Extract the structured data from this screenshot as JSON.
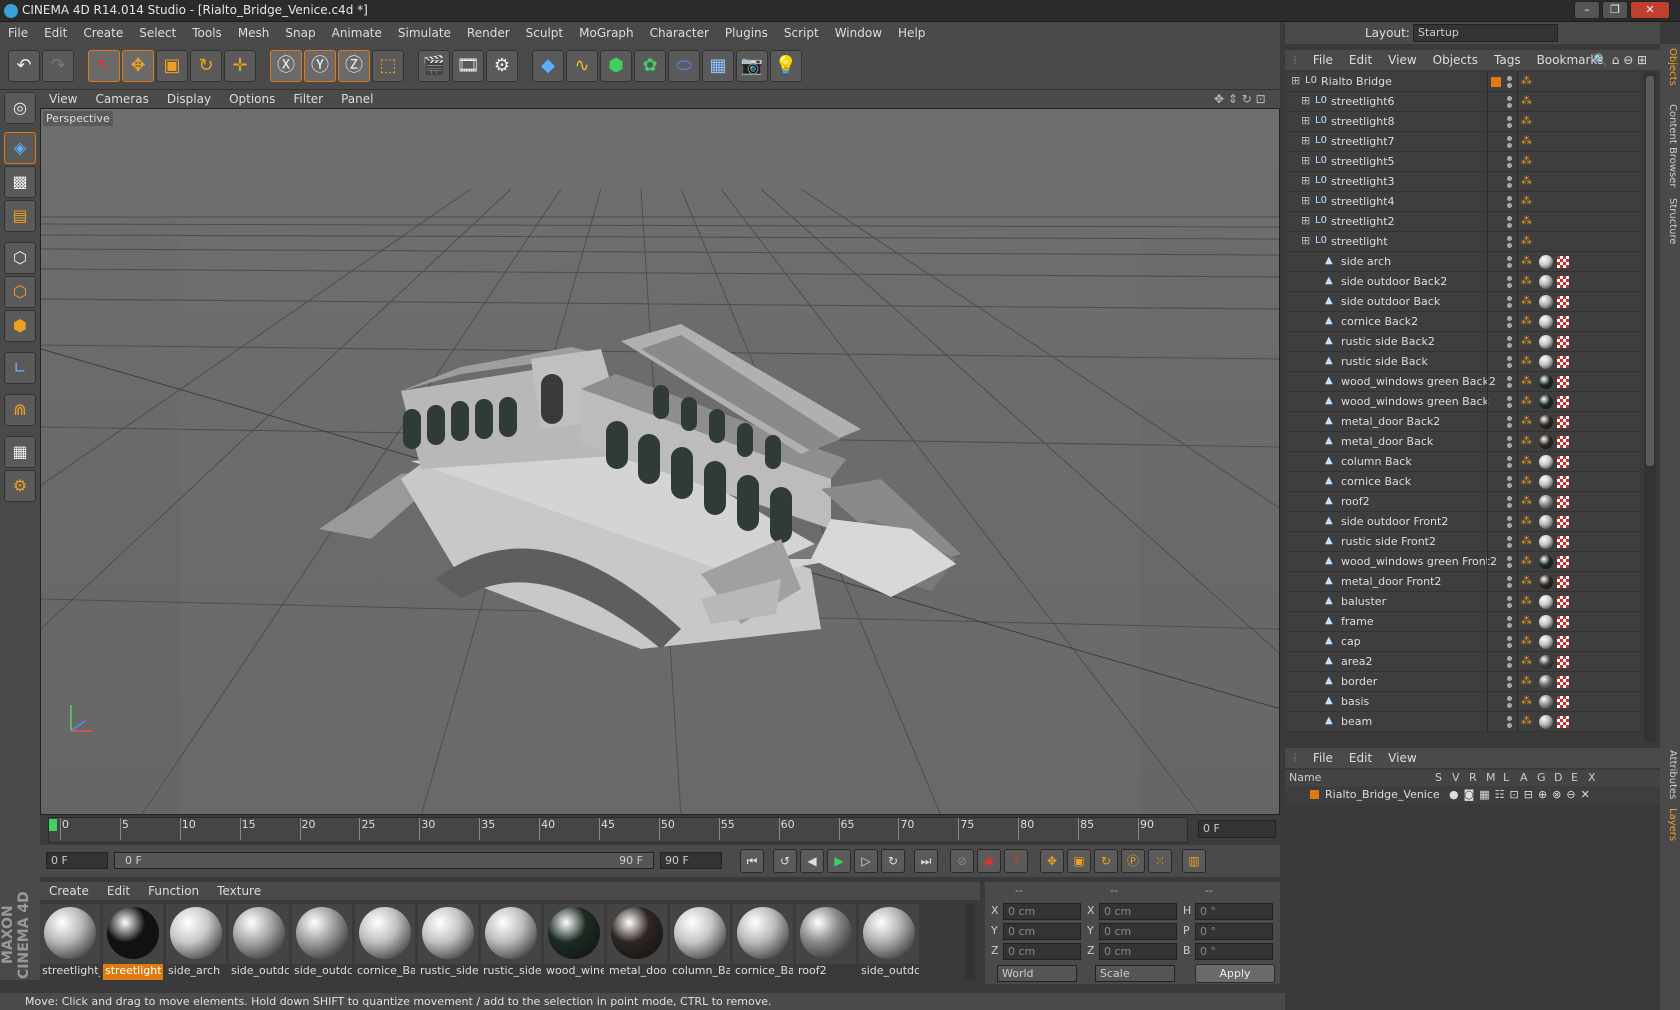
{
  "window": {
    "title": "CINEMA 4D R14.014 Studio - [Rialto_Bridge_Venice.c4d *]",
    "layout_label": "Layout:",
    "layout_value": "Startup"
  },
  "menubar": [
    "File",
    "Edit",
    "Create",
    "Select",
    "Tools",
    "Mesh",
    "Snap",
    "Animate",
    "Simulate",
    "Render",
    "Sculpt",
    "MoGraph",
    "Character",
    "Plugins",
    "Script",
    "Window",
    "Help"
  ],
  "viewport": {
    "menu": [
      "View",
      "Cameras",
      "Display",
      "Options",
      "Filter",
      "Panel"
    ],
    "label": "Perspective"
  },
  "timeline": {
    "ticks": [
      "0",
      "5",
      "10",
      "15",
      "20",
      "25",
      "30",
      "35",
      "40",
      "45",
      "50",
      "55",
      "60",
      "65",
      "70",
      "75",
      "80",
      "85",
      "90"
    ],
    "current": "0 F",
    "start": "0 F",
    "range_start": "0 F",
    "range_end": "90 F",
    "end": "90 F"
  },
  "materials": {
    "menu": [
      "Create",
      "Edit",
      "Function",
      "Texture"
    ],
    "items": [
      {
        "name": "streetlight_",
        "color": "#b8b8b8"
      },
      {
        "name": "streetlight",
        "color": "#111111",
        "selected": true
      },
      {
        "name": "side_arch",
        "color": "#c8c8c8"
      },
      {
        "name": "side_outdc",
        "color": "#a8a8a8"
      },
      {
        "name": "side_outdc",
        "color": "#a0a0a0"
      },
      {
        "name": "cornice_Ba",
        "color": "#c0c0c0"
      },
      {
        "name": "rustic_side",
        "color": "#c4c4c4"
      },
      {
        "name": "rustic_side",
        "color": "#bcbcbc"
      },
      {
        "name": "wood_wine",
        "color": "#1c2a22"
      },
      {
        "name": "metal_dooi",
        "color": "#2e2520"
      },
      {
        "name": "column_Ba",
        "color": "#c6c6c6"
      },
      {
        "name": "cornice_Ba",
        "color": "#bababa"
      },
      {
        "name": "roof2",
        "color": "#8a8a8a"
      },
      {
        "name": "side_outdc",
        "color": "#b0b0b0"
      }
    ]
  },
  "coordinates": {
    "header": [
      "--",
      "--",
      "--"
    ],
    "rows": [
      {
        "a": "X",
        "av": "0 cm",
        "b": "X",
        "bv": "0 cm",
        "c": "H",
        "cv": "0 °"
      },
      {
        "a": "Y",
        "av": "0 cm",
        "b": "Y",
        "bv": "0 cm",
        "c": "P",
        "cv": "0 °"
      },
      {
        "a": "Z",
        "av": "0 cm",
        "b": "Z",
        "bv": "0 cm",
        "c": "B",
        "cv": "0 °"
      }
    ],
    "space": "World",
    "mode": "Scale",
    "apply": "Apply"
  },
  "status": "Move: Click and drag to move elements. Hold down SHIFT to quantize movement / add to the selection in point mode, CTRL to remove.",
  "objects": {
    "menu": [
      "File",
      "Edit",
      "View",
      "Objects",
      "Tags",
      "Bookmarks"
    ],
    "items": [
      {
        "name": "Rialto Bridge",
        "type": "null",
        "mat": ""
      },
      {
        "name": "streetlight6",
        "type": "null",
        "mat": ""
      },
      {
        "name": "streetlight8",
        "type": "null",
        "mat": ""
      },
      {
        "name": "streetlight7",
        "type": "null",
        "mat": ""
      },
      {
        "name": "streetlight5",
        "type": "null",
        "mat": ""
      },
      {
        "name": "streetlight3",
        "type": "null",
        "mat": ""
      },
      {
        "name": "streetlight4",
        "type": "null",
        "mat": ""
      },
      {
        "name": "streetlight2",
        "type": "null",
        "mat": ""
      },
      {
        "name": "streetlight",
        "type": "null",
        "mat": ""
      },
      {
        "name": "side arch",
        "type": "poly",
        "mat": "#c8c8c8"
      },
      {
        "name": "side outdoor Back2",
        "type": "poly",
        "mat": "#b0b0b0"
      },
      {
        "name": "side outdoor Back",
        "type": "poly",
        "mat": "#b0b0b0"
      },
      {
        "name": "cornice Back2",
        "type": "poly",
        "mat": "#c0c0c0"
      },
      {
        "name": "rustic side Back2",
        "type": "poly",
        "mat": "#c0c0c0"
      },
      {
        "name": "rustic side Back",
        "type": "poly",
        "mat": "#c0c0c0"
      },
      {
        "name": "wood_windows green Back2",
        "type": "poly",
        "mat": "#1c2a22"
      },
      {
        "name": "wood_windows green Back",
        "type": "poly",
        "mat": "#1c2a22"
      },
      {
        "name": "metal_door Back2",
        "type": "poly",
        "mat": "#2e2520"
      },
      {
        "name": "metal_door Back",
        "type": "poly",
        "mat": "#2e2520"
      },
      {
        "name": "column Back",
        "type": "poly",
        "mat": "#c6c6c6"
      },
      {
        "name": "cornice Back",
        "type": "poly",
        "mat": "#c0c0c0"
      },
      {
        "name": "roof2",
        "type": "poly",
        "mat": "#8a8a8a"
      },
      {
        "name": "side outdoor Front2",
        "type": "poly",
        "mat": "#b0b0b0"
      },
      {
        "name": "rustic side Front2",
        "type": "poly",
        "mat": "#c0c0c0"
      },
      {
        "name": "wood_windows green Front2",
        "type": "poly",
        "mat": "#1c2a22"
      },
      {
        "name": "metal_door Front2",
        "type": "poly",
        "mat": "#2e2520"
      },
      {
        "name": "baluster",
        "type": "poly",
        "mat": "#c8c8c8"
      },
      {
        "name": "frame",
        "type": "poly",
        "mat": "#c0c0c0"
      },
      {
        "name": "cap",
        "type": "poly",
        "mat": "#c0c0c0"
      },
      {
        "name": "area2",
        "type": "poly",
        "mat": "#444444"
      },
      {
        "name": "border",
        "type": "poly",
        "mat": "#707070"
      },
      {
        "name": "basis",
        "type": "poly",
        "mat": "#909090"
      },
      {
        "name": "beam",
        "type": "poly",
        "mat": "#b0b0b0"
      }
    ]
  },
  "layers": {
    "menu": [
      "File",
      "Edit",
      "View"
    ],
    "columns": [
      "Name",
      "S",
      "V",
      "R",
      "M",
      "L",
      "A",
      "G",
      "D",
      "E",
      "X"
    ],
    "item": "Rialto_Bridge_Venice"
  },
  "side_tabs": [
    "Objects",
    "Content Browser",
    "Structure",
    "Attributes",
    "Layers"
  ],
  "branding": "MAXON CINEMA 4D"
}
